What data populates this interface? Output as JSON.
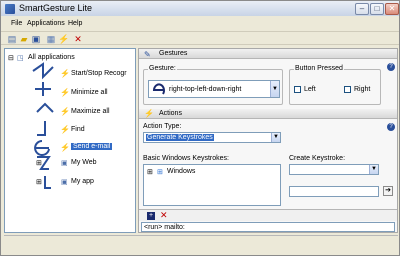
{
  "window": {
    "title": "SmartGesture Lite"
  },
  "menu": {
    "items": [
      "File",
      "Applications",
      "Help"
    ]
  },
  "toolbar": {
    "icons": [
      "new-icon",
      "open-icon",
      "save-icon",
      "properties-icon",
      "lightning-icon",
      "delete-icon"
    ]
  },
  "tree": {
    "root": "All applications",
    "items": [
      {
        "label": "Start/Stop Recogr",
        "icon": "lightning-icon"
      },
      {
        "label": "Minimize all",
        "icon": "lightning-icon"
      },
      {
        "label": "Maximize all",
        "icon": "lightning-icon"
      },
      {
        "label": "Find",
        "icon": "lightning-icon"
      },
      {
        "label": "Send e-mail",
        "icon": "lightning-icon",
        "selected": true
      },
      {
        "label": "My Web",
        "icon": "app-icon"
      },
      {
        "label": "My app",
        "icon": "app-icon"
      }
    ]
  },
  "gestures_section": {
    "title": "Gestures",
    "gesture_label": "Gesture:",
    "gesture_value": "right-top-left-down-right",
    "button_pressed_label": "Button Pressed",
    "left_label": "Left",
    "right_label": "Right"
  },
  "actions_section": {
    "title": "Actions",
    "action_type_label": "Action Type:",
    "action_type_value": "Generate Keystrokes",
    "basic_keystrokes_label": "Basic Windows Keystrokes:",
    "basic_keystrokes_item": "Windows",
    "create_keystroke_label": "Create Keystroke:"
  },
  "script": {
    "text": "<run> mailto:"
  },
  "colors": {
    "selection": "#316ac5",
    "accent": "#2a4f9a",
    "lightning": "#d1a000"
  }
}
